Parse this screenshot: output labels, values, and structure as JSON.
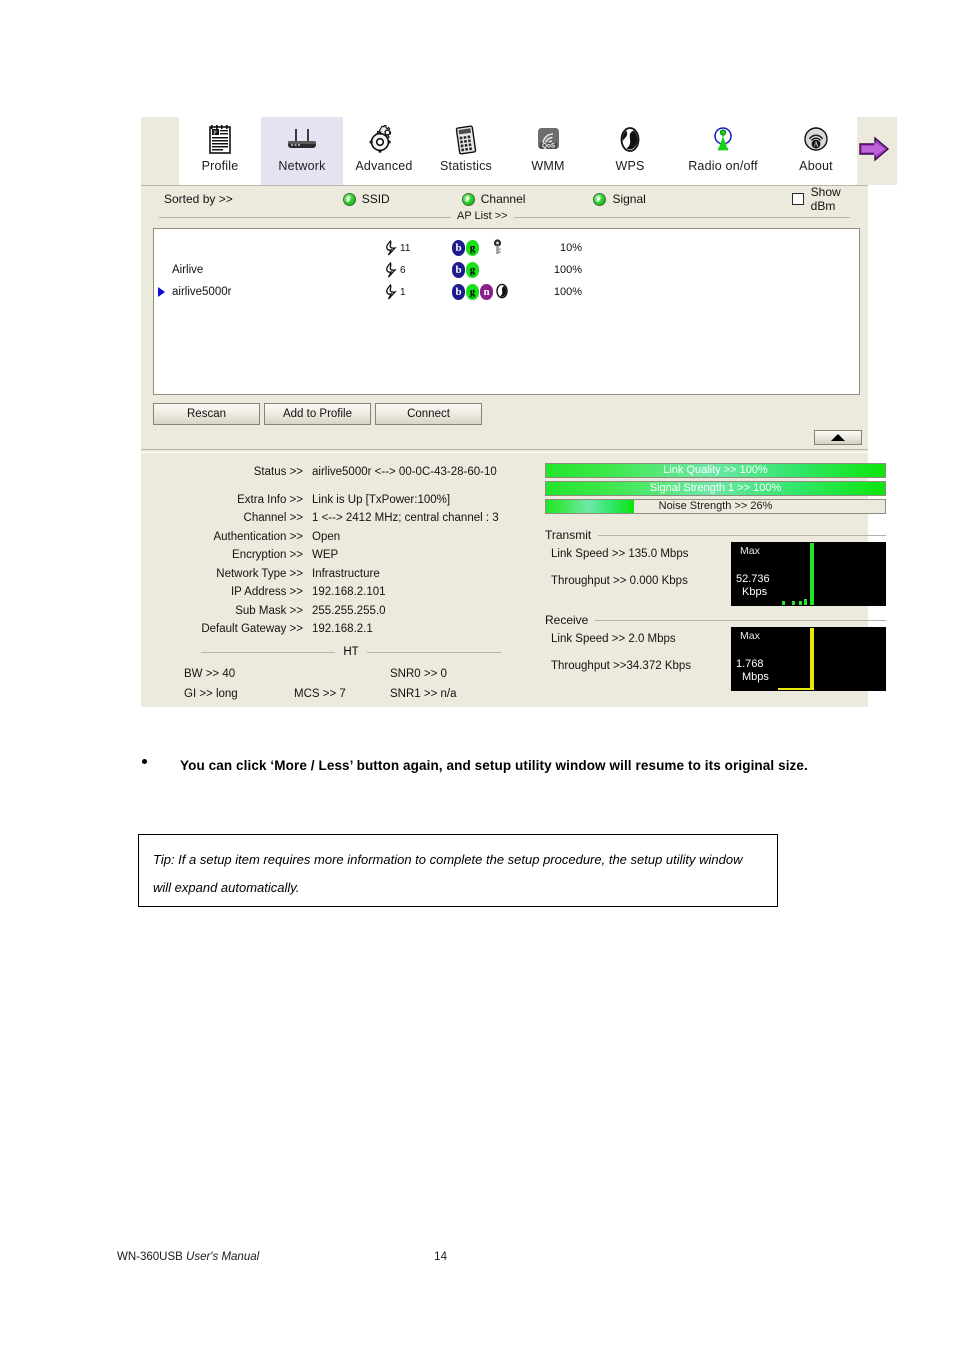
{
  "app": {
    "toolbar": {
      "tabs": [
        {
          "label": "Profile",
          "icon": "profile-icon",
          "active": false
        },
        {
          "label": "Network",
          "icon": "router-icon",
          "active": true
        },
        {
          "label": "Advanced",
          "icon": "gears-icon",
          "active": false
        },
        {
          "label": "Statistics",
          "icon": "calculator-icon",
          "active": false
        },
        {
          "label": "WMM",
          "icon": "qos-icon",
          "active": false
        },
        {
          "label": "WPS",
          "icon": "wps-icon",
          "active": false
        },
        {
          "label": "Radio on/off",
          "icon": "radio-tower-icon",
          "active": false
        },
        {
          "label": "About",
          "icon": "about-icon",
          "active": false
        }
      ],
      "more_icon": "purple-right-arrow-icon"
    },
    "sort_bar": {
      "label": "Sorted by >>",
      "options": [
        {
          "label": "SSID",
          "selected": true
        },
        {
          "label": "Channel",
          "selected": true
        },
        {
          "label": "Signal",
          "selected": true
        }
      ],
      "show_dbm": {
        "label": "Show dBm",
        "checked": false
      }
    },
    "ap_list": {
      "caption": "AP List >>",
      "rows": [
        {
          "ssid": "",
          "selected": false,
          "channel": "11",
          "caps": [
            "b",
            "g"
          ],
          "secured": true,
          "signal_pct": "10%",
          "signal_value": 10
        },
        {
          "ssid": "Airlive",
          "selected": false,
          "channel": "6",
          "caps": [
            "b",
            "g"
          ],
          "secured": false,
          "signal_pct": "100%",
          "signal_value": 100
        },
        {
          "ssid": "airlive5000r",
          "selected": true,
          "channel": "1",
          "caps": [
            "b",
            "g",
            "n"
          ],
          "secured": false,
          "wps": true,
          "signal_pct": "100%",
          "signal_value": 100
        }
      ]
    },
    "buttons": {
      "rescan": "Rescan",
      "add_to_profile": "Add to Profile",
      "connect": "Connect",
      "more_less": "More / Less"
    },
    "details": {
      "rows": [
        {
          "key": "Status >>",
          "value": "airlive5000r <--> 00-0C-43-28-60-10"
        },
        {
          "key": "Extra Info >>",
          "value": "Link is Up [TxPower:100%]"
        },
        {
          "key": "Channel >>",
          "value": "1 <--> 2412 MHz; central channel : 3"
        },
        {
          "key": "Authentication >>",
          "value": "Open"
        },
        {
          "key": "Encryption >>",
          "value": "WEP"
        },
        {
          "key": "Network Type >>",
          "value": "Infrastructure"
        },
        {
          "key": "IP Address >>",
          "value": "192.168.2.101"
        },
        {
          "key": "Sub Mask >>",
          "value": "255.255.255.0"
        },
        {
          "key": "Default Gateway >>",
          "value": "192.168.2.1"
        }
      ],
      "ht_caption": "HT",
      "ht": {
        "bw": "BW >> 40",
        "gi": "GI >> long",
        "mcs": "MCS >>  7",
        "snr0": "SNR0 >>  0",
        "snr1": "SNR1 >>  n/a"
      }
    },
    "meters": [
      {
        "label": "Link Quality >> 100%",
        "value": 100,
        "style": "light"
      },
      {
        "label": "Signal Strength 1 >> 100%",
        "value": 100,
        "style": "light"
      },
      {
        "label": "Noise Strength >> 26%",
        "value": 26,
        "style": "dark"
      }
    ],
    "transmit": {
      "caption": "Transmit",
      "link_speed": "Link Speed >>  135.0 Mbps",
      "throughput": "Throughput >> 0.000 Kbps",
      "graph": {
        "max_label": "Max",
        "value": "52.736",
        "unit": "Kbps",
        "color": "#22e52c"
      }
    },
    "receive": {
      "caption": "Receive",
      "link_speed": "Link Speed >> 2.0 Mbps",
      "throughput": "Throughput >>34.372 Kbps",
      "graph": {
        "max_label": "Max",
        "value": "1.768",
        "unit": "Mbps",
        "color": "#e8e800"
      }
    }
  },
  "page": {
    "bullet": "You can click ‘More / Less’ button again, and setup utility window will resume to its original size.",
    "tip": "Tip: If a setup item requires more information to complete the setup procedure, the setup utility window will expand automatically.",
    "footer_manual_product": "WN-360USB ",
    "footer_manual_title": "User's Manual",
    "footer_page": "14"
  }
}
